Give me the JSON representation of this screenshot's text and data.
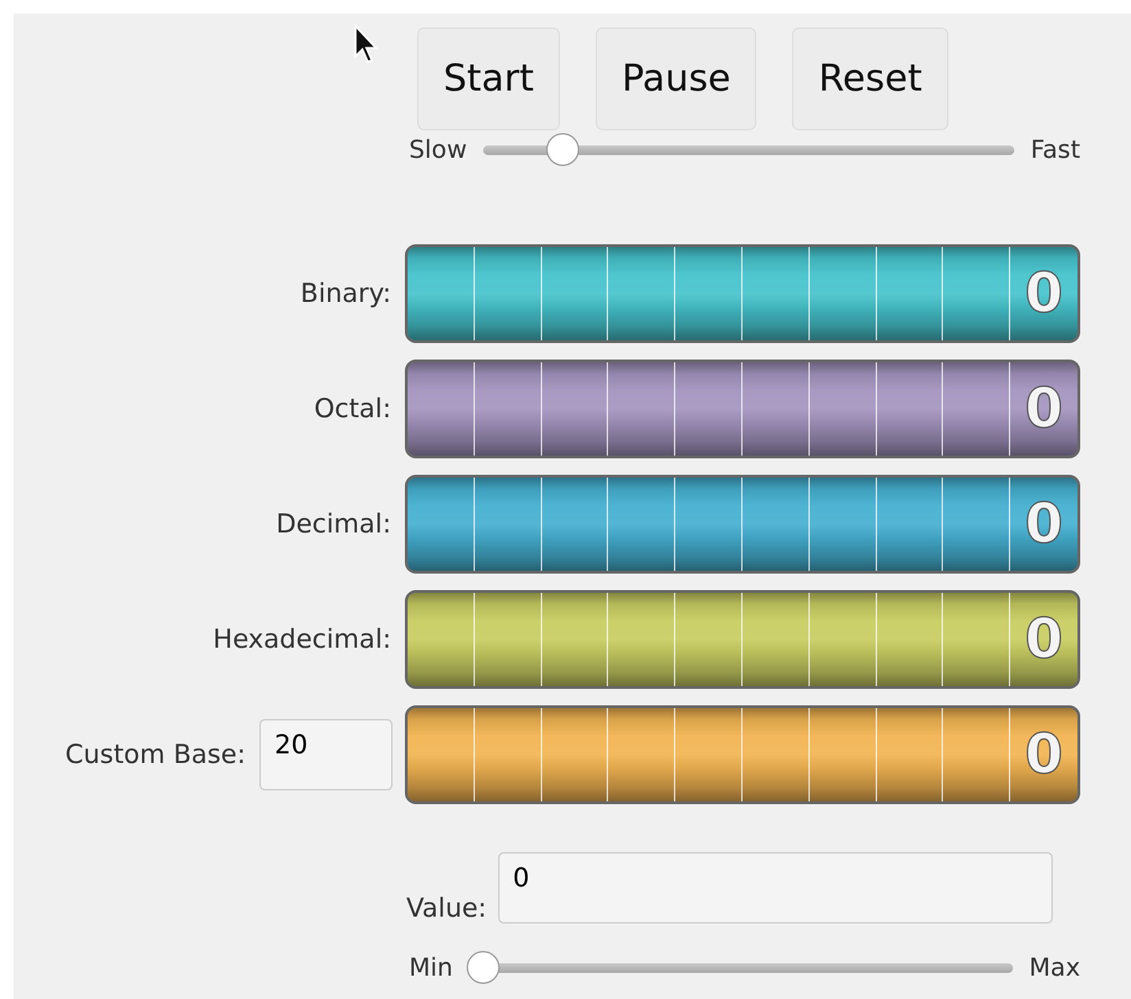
{
  "buttons": [
    {
      "label": "Start"
    },
    {
      "label": "Pause"
    },
    {
      "label": "Reset"
    }
  ],
  "speed_slider": {
    "min_label": "Slow",
    "max_label": "Fast",
    "level": 0.13
  },
  "counters": [
    {
      "label": "Binary:",
      "kind": "fixed",
      "color": "#46c3cc",
      "reading": "0"
    },
    {
      "label": "Octal:",
      "kind": "fixed",
      "color": "#a394be",
      "reading": "0"
    },
    {
      "label": "Decimal:",
      "kind": "fixed",
      "color": "#45b0d0",
      "reading": "0"
    },
    {
      "label": "Hexadecimal:",
      "kind": "fixed",
      "color": "#c8cd62",
      "reading": "0"
    },
    {
      "label": "Custom Base:",
      "kind": "custom",
      "base": "20",
      "color": "#f2b452",
      "reading": "0"
    }
  ],
  "value_field": {
    "label": "Value:",
    "value": "0"
  },
  "value_slider": {
    "min_label": "Min",
    "max_label": "Max",
    "level": 0
  }
}
